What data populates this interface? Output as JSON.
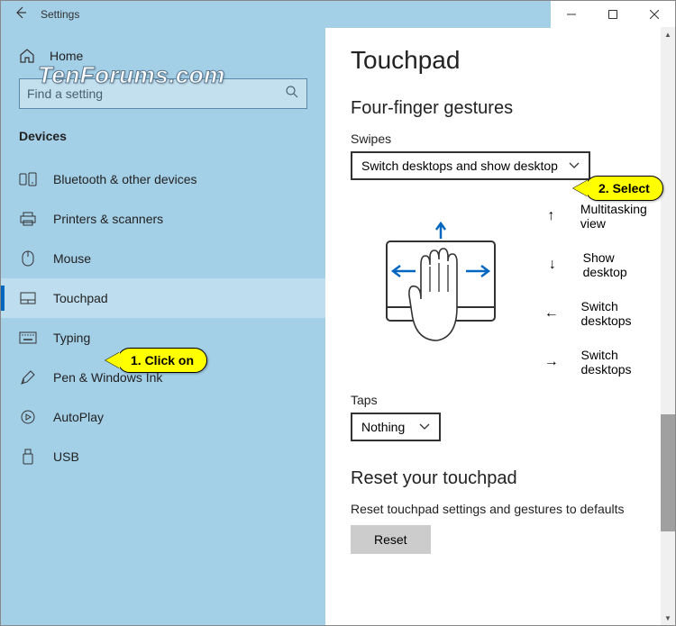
{
  "window": {
    "title": "Settings"
  },
  "watermark": "TenForums.com",
  "sidebar": {
    "home_label": "Home",
    "search_placeholder": "Find a setting",
    "category": "Devices",
    "items": [
      {
        "label": "Bluetooth & other devices",
        "icon": "bluetooth-devices-icon"
      },
      {
        "label": "Printers & scanners",
        "icon": "printer-icon"
      },
      {
        "label": "Mouse",
        "icon": "mouse-icon"
      },
      {
        "label": "Touchpad",
        "icon": "touchpad-icon",
        "selected": true
      },
      {
        "label": "Typing",
        "icon": "keyboard-icon"
      },
      {
        "label": "Pen & Windows Ink",
        "icon": "pen-icon"
      },
      {
        "label": "AutoPlay",
        "icon": "autoplay-icon"
      },
      {
        "label": "USB",
        "icon": "usb-icon"
      }
    ]
  },
  "main": {
    "page_title": "Touchpad",
    "section_title": "Four-finger gestures",
    "swipes_label": "Swipes",
    "swipes_value": "Switch desktops and show desktop",
    "legend": [
      {
        "arrow": "↑",
        "text": "Multitasking view"
      },
      {
        "arrow": "↓",
        "text": "Show desktop"
      },
      {
        "arrow": "←",
        "text": "Switch desktops"
      },
      {
        "arrow": "→",
        "text": "Switch desktops"
      }
    ],
    "taps_label": "Taps",
    "taps_value": "Nothing",
    "reset_title": "Reset your touchpad",
    "reset_desc": "Reset touchpad settings and gestures to defaults",
    "reset_button": "Reset"
  },
  "callouts": {
    "c1": "1. Click on",
    "c2": "2. Select"
  }
}
